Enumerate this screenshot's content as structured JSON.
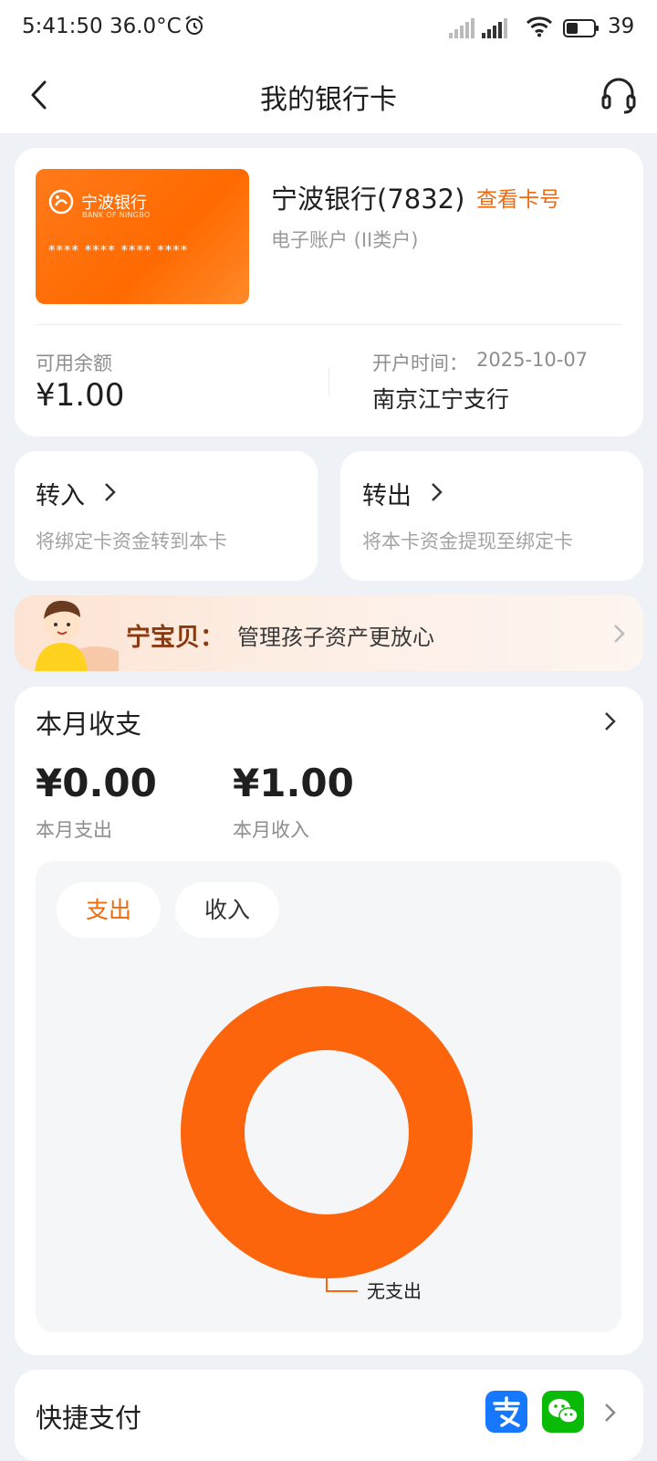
{
  "status_bar": {
    "time_temp": "5:41:50 36.0°C",
    "battery": "39"
  },
  "nav": {
    "title": "我的银行卡"
  },
  "card": {
    "bank_logo_text": "宁波银行",
    "bank_logo_en": "BANK OF NINGBO",
    "masked_number": "**** **** **** ****",
    "bank_name": "宁波银行(7832)",
    "view_number_link": "查看卡号",
    "account_type": "电子账户 (II类户)",
    "balance_label": "可用余额",
    "balance": "¥1.00",
    "open_date_label": "开户时间：",
    "open_date": "2025-10-07",
    "branch": "南京江宁支行"
  },
  "actions": {
    "transfer_in": {
      "title": "转入",
      "desc": "将绑定卡资金转到本卡"
    },
    "transfer_out": {
      "title": "转出",
      "desc": "将本卡资金提现至绑定卡"
    }
  },
  "banner": {
    "title": "宁宝贝：",
    "desc": "管理孩子资产更放心"
  },
  "monthly": {
    "title": "本月收支",
    "expense_amount": "¥0.00",
    "expense_label": "本月支出",
    "income_amount": "¥1.00",
    "income_label": "本月收入",
    "tabs": {
      "expense": "支出",
      "income": "收入"
    },
    "active_tab": "expense"
  },
  "chart_data": {
    "type": "pie",
    "labels": [
      "无支出"
    ],
    "values": [
      1
    ],
    "colors": [
      "#fc650c"
    ]
  },
  "quick_pay": {
    "title": "快捷支付",
    "icons": [
      "alipay-icon",
      "wechat-pay-icon"
    ]
  },
  "colors": {
    "accent": "#fc650c",
    "link": "#f06a0f",
    "background": "#eef1f6"
  }
}
